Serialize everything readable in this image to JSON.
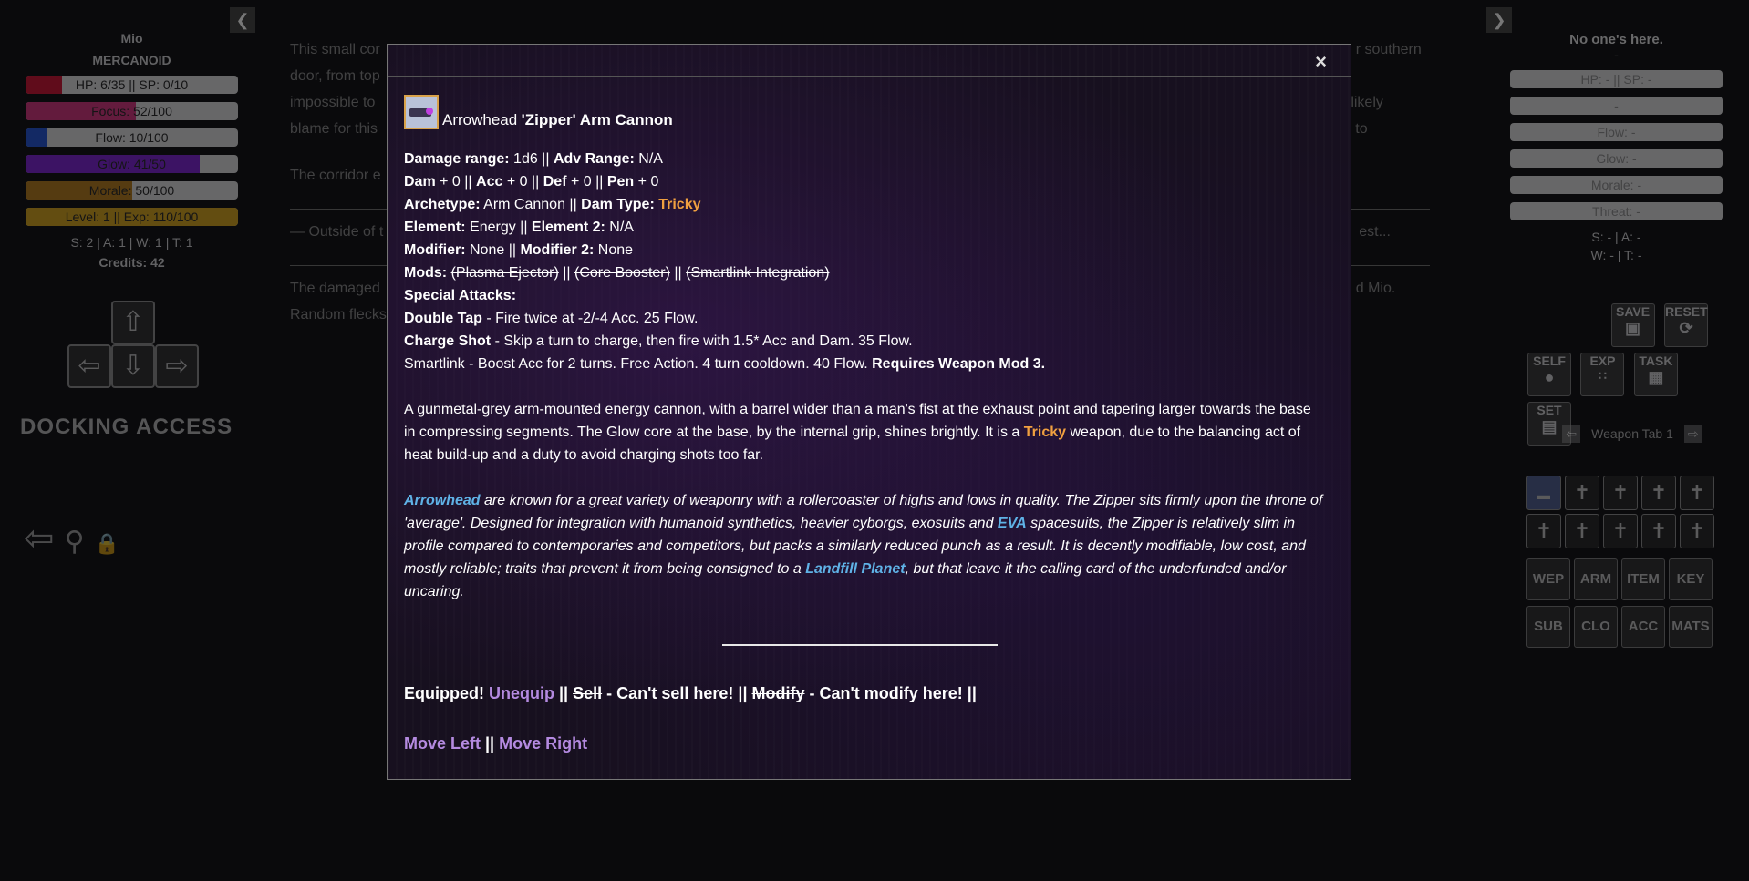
{
  "left_panel": {
    "name": "Mio",
    "race": "MERCANOID",
    "bars": [
      {
        "label": "HP: 6/35 || SP: 0/10",
        "color": "#c8102e",
        "fill": 0.17
      },
      {
        "label": "Focus: 52/100",
        "color": "#d0307a",
        "fill": 0.52
      },
      {
        "label": "Flow: 10/100",
        "color": "#1f4fd0",
        "fill": 0.1
      },
      {
        "label": "Glow: 41/50",
        "color": "#7a1fd0",
        "fill": 0.82
      },
      {
        "label": "Morale: 50/100",
        "color": "#b07818",
        "fill": 0.5
      },
      {
        "label": "Level: 1 || Exp: 110/100",
        "color": "#d0a018",
        "fill": 1.0
      }
    ],
    "stats_line": "S: 2 | A: 1 | W: 1 | T: 1",
    "credits": "Credits: 42",
    "location": "DOCKING ACCESS",
    "dpad": {
      "up": "up-arrow-icon",
      "left": "left-arrow-icon",
      "down": "down-arrow-icon",
      "right": "right-arrow-icon"
    }
  },
  "main_text": {
    "p1_start": "This small cor",
    "p1_rest": "r southern door, from top",
    "p1_line3_start": "impossible to",
    "p1_line3_end": "ob to",
    "p1_line4": "blame for this",
    "p1_right2": "t's likely",
    "p2": "The corridor e",
    "p3_start": "— Outside of t",
    "p3_end": "est...",
    "p4_line1": "The damaged",
    "p4_line1_end": "d Mio.",
    "p4_line2": "Random flecks"
  },
  "right_panel": {
    "title": "No one's here.",
    "subtitle": "-",
    "bars": [
      "HP: - || SP: -",
      "-",
      "Flow: -",
      "Glow: -",
      "Morale: -",
      "Threat: -"
    ],
    "stats_line1": "S: - | A: -",
    "stats_line2": "W: - | T: -",
    "tools": [
      "SAVE",
      "RESET",
      "SELF",
      "EXP",
      "TASK",
      "SET"
    ],
    "weapon_tab": "Weapon Tab 1",
    "categories": [
      "WEP",
      "ARM",
      "ITEM",
      "KEY",
      "SUB",
      "CLO",
      "ACC",
      "MATS"
    ]
  },
  "modal": {
    "close": "×",
    "title_plain": "Arrowhead ",
    "title_bold": "'Zipper' Arm Cannon",
    "damage_range_label": "Damage range:",
    "damage_range_value": " 1d6 || ",
    "adv_range_label": "Adv Range:",
    "adv_range_value": " N/A",
    "dam_label": "Dam",
    "dam_value": " + 0 || ",
    "acc_label": "Acc",
    "acc_value": " + 0 || ",
    "def_label": "Def",
    "def_value": " + 0 || ",
    "pen_label": "Pen",
    "pen_value": " + 0",
    "archetype_label": "Archetype:",
    "archetype_value": " Arm Cannon || ",
    "damtype_label": "Dam Type:",
    "damtype_value": "Tricky",
    "element_label": "Element:",
    "element_value": " Energy || ",
    "element2_label": "Element 2:",
    "element2_value": " N/A",
    "modifier_label": "Modifier:",
    "modifier_value": " None || ",
    "modifier2_label": "Modifier 2:",
    "modifier2_value": " None",
    "mods_label": "Mods:",
    "mod1": "(Plasma Ejector)",
    "mod2": "(Core Booster)",
    "mod3": "(Smartlink Integration)",
    "mods_sep": " || ",
    "special_label": "Special Attacks:",
    "atk1_name": "Double Tap",
    "atk1_desc": " - Fire twice at -2/-4 Acc. 25 Flow.",
    "atk2_name": "Charge Shot",
    "atk2_desc": " - Skip a turn to charge, then fire with 1.5* Acc and Dam. 35 Flow.",
    "atk3_name": "Smartlink",
    "atk3_desc": " - Boost Acc for 2 turns. Free Action. 4 turn cooldown. 40 Flow. ",
    "atk3_req": "Requires Weapon Mod 3.",
    "desc_1": "A gunmetal-grey arm-mounted energy cannon, with a barrel wider than a man's fist at the exhaust point and tapering larger towards the base in compressing segments. The Glow core at the base, by the internal grip, shines brightly. It is a ",
    "desc_tricky": "Tricky",
    "desc_2": " weapon, due to the balancing act of heat build-up and a duty to avoid charging shots too far.",
    "lore_arrowhead": "Arrowhead",
    "lore_1": " are known for a great variety of weaponry with a rollercoaster of highs and lows in quality. The Zipper sits firmly upon the throne of 'average'. Designed for integration with humanoid synthetics, heavier cyborgs, exosuits and ",
    "lore_eva": "EVA",
    "lore_2": " spacesuits, the Zipper is relatively slim in profile compared to contemporaries and competitors, but packs a similarly reduced punch as a result. It is decently modifiable, low cost, and mostly reliable; traits that prevent it from being consigned to a ",
    "lore_landfill": "Landfill Planet",
    "lore_3": ", but that leave it the calling card of the underfunded and/or uncaring.",
    "equipped": "Equipped! ",
    "unequip": "Unequip",
    "sep": " || ",
    "sell": "Sell",
    "sell_note": " - Can't sell here! || ",
    "modify": "Modify",
    "modify_note": " - Can't modify here! ||",
    "move_left": "Move Left",
    "move_right": "Move Right"
  },
  "colors": {
    "orange": "#f0a040",
    "blue": "#5fb2e6",
    "purple": "#b48ae0",
    "icon_border": "#d9a24a"
  }
}
